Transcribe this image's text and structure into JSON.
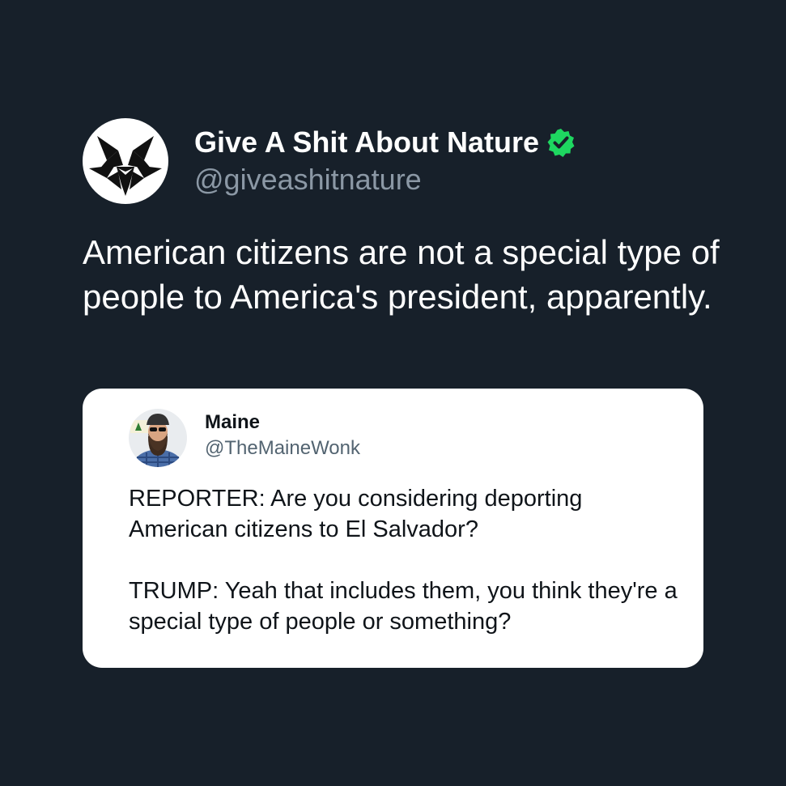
{
  "author": {
    "display_name": "Give A Shit About Nature",
    "handle": "@giveashitnature",
    "avatar_icon": "wolf-logo-icon",
    "verified_icon": "verified-badge-icon",
    "verified_color": "#1ed760"
  },
  "tweet": {
    "text": "American citizens are not a special type of people to America's president, apparently."
  },
  "quoted": {
    "display_name": "Maine",
    "handle": "@TheMaineWonk",
    "avatar_icon": "bearded-man-avatar-icon",
    "paragraphs": [
      "REPORTER: Are you considering deporting American citizens to El Salvador?",
      "TRUMP: Yeah that includes them, you think they're a special type of people or something?"
    ]
  },
  "colors": {
    "background": "#17202a",
    "card": "#ffffff",
    "handle_gray": "#8b98a5"
  }
}
